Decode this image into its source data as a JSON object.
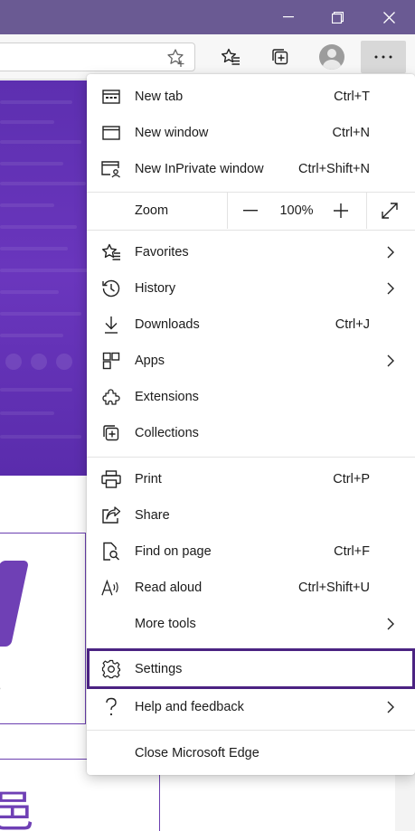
{
  "window": {
    "minimize_glyph": "—",
    "maximize_glyph": "❐",
    "close_glyph": "✕"
  },
  "toolbar": {
    "more_glyph": "···"
  },
  "page": {
    "card1_text": "s",
    "card2_glyph": "⾢"
  },
  "menu": {
    "items": [
      {
        "label": "New tab",
        "shortcut": "Ctrl+T",
        "icon": "new-tab-icon"
      },
      {
        "label": "New window",
        "shortcut": "Ctrl+N",
        "icon": "new-window-icon"
      },
      {
        "label": "New InPrivate window",
        "shortcut": "Ctrl+Shift+N",
        "icon": "inprivate-icon"
      }
    ],
    "zoom": {
      "label": "Zoom",
      "value": "100%"
    },
    "items2": [
      {
        "label": "Favorites",
        "icon": "favorites-icon",
        "submenu": true
      },
      {
        "label": "History",
        "icon": "history-icon",
        "submenu": true
      },
      {
        "label": "Downloads",
        "shortcut": "Ctrl+J",
        "icon": "downloads-icon"
      },
      {
        "label": "Apps",
        "icon": "apps-icon",
        "submenu": true
      },
      {
        "label": "Extensions",
        "icon": "extensions-icon"
      },
      {
        "label": "Collections",
        "icon": "collections-icon"
      }
    ],
    "items3": [
      {
        "label": "Print",
        "shortcut": "Ctrl+P",
        "icon": "print-icon"
      },
      {
        "label": "Share",
        "icon": "share-icon"
      },
      {
        "label": "Find on page",
        "shortcut": "Ctrl+F",
        "icon": "find-icon"
      },
      {
        "label": "Read aloud",
        "shortcut": "Ctrl+Shift+U",
        "icon": "read-aloud-icon"
      },
      {
        "label": "More tools",
        "submenu": true
      }
    ],
    "settings": {
      "label": "Settings",
      "icon": "gear-icon"
    },
    "help": {
      "label": "Help and feedback",
      "icon": "help-icon",
      "submenu": true
    },
    "close": {
      "label": "Close Microsoft Edge"
    },
    "highlight_color": "#4b2382"
  }
}
